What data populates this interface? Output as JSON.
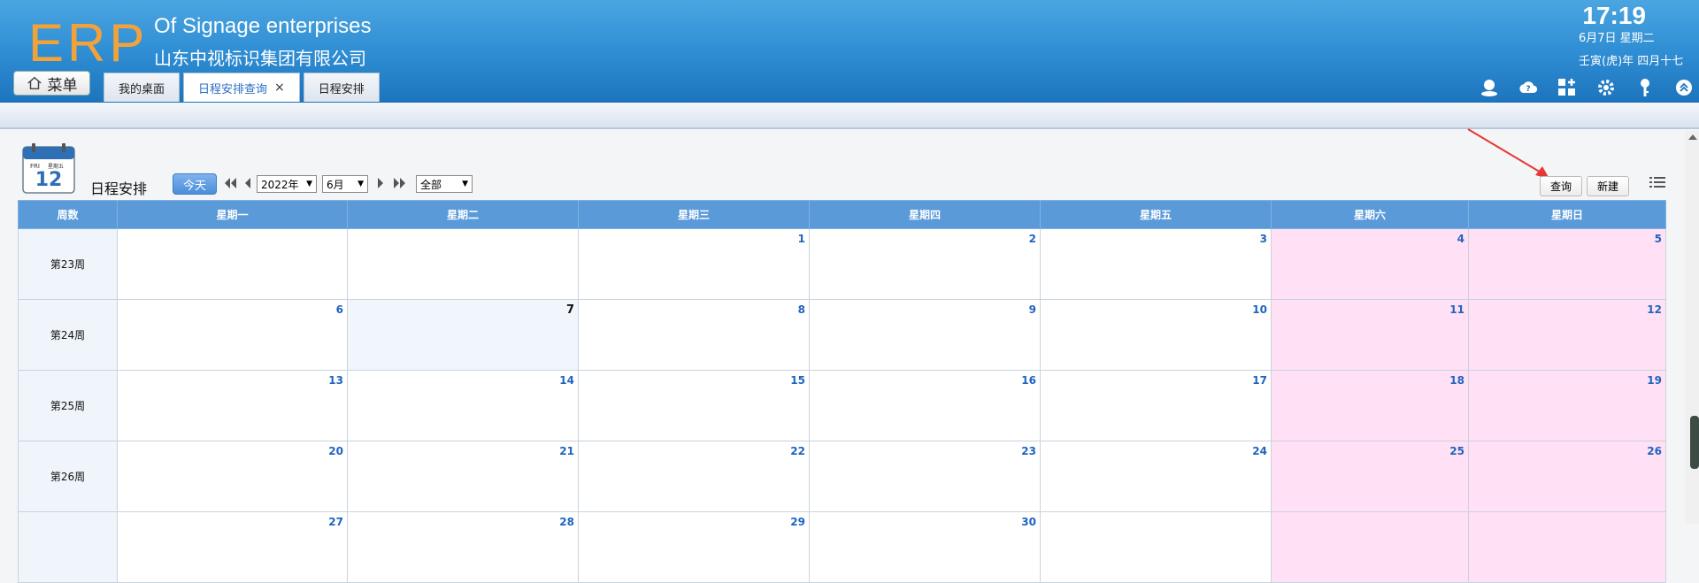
{
  "header": {
    "logo_text": "ERP",
    "company_en": "Of Signage enterprises",
    "company_cn": "山东中视标识集团有限公司",
    "menu_label": "菜单",
    "tabs": [
      {
        "label": "我的桌面"
      },
      {
        "label": "日程安排查询",
        "close": "×"
      },
      {
        "label": "日程安排"
      }
    ],
    "clock": "17:19",
    "date_line1": "6月7日 星期二",
    "date_line2": "壬寅(虎)年 四月十七",
    "icons": [
      "user-status-icon",
      "cloud-help-icon",
      "add-widget-icon",
      "settings-gear-icon",
      "key-icon",
      "collapse-up-icon"
    ]
  },
  "toolbar": {
    "calendar_icon_day": "FRI",
    "calendar_icon_cn": "星期五",
    "calendar_icon_num": "12",
    "title": "日程安排",
    "today_label": "今天",
    "year_value": "2022年",
    "month_value": "6月",
    "filter_value": "全部",
    "query_label": "查询",
    "new_label": "新建"
  },
  "calendar": {
    "headers": [
      "周数",
      "星期一",
      "星期二",
      "星期三",
      "星期四",
      "星期五",
      "星期六",
      "星期日"
    ],
    "weeks": [
      {
        "label": "第23周",
        "days": [
          "",
          "",
          "1",
          "2",
          "3",
          "4",
          "5"
        ]
      },
      {
        "label": "第24周",
        "days": [
          "6",
          "7",
          "8",
          "9",
          "10",
          "11",
          "12"
        ]
      },
      {
        "label": "第25周",
        "days": [
          "13",
          "14",
          "15",
          "16",
          "17",
          "18",
          "19"
        ]
      },
      {
        "label": "第26周",
        "days": [
          "20",
          "21",
          "22",
          "23",
          "24",
          "25",
          "26"
        ]
      },
      {
        "label": "",
        "days": [
          "27",
          "28",
          "29",
          "30",
          "",
          "",
          ""
        ]
      }
    ],
    "today": "7"
  },
  "colors": {
    "header_bg": "#2f8ed4",
    "logo_orange": "#f3a23a",
    "grid_header": "#5b9ad9",
    "weekend_bg": "#ffe0f5",
    "day_number": "#1f64c0",
    "annotation_arrow": "#e53935"
  }
}
